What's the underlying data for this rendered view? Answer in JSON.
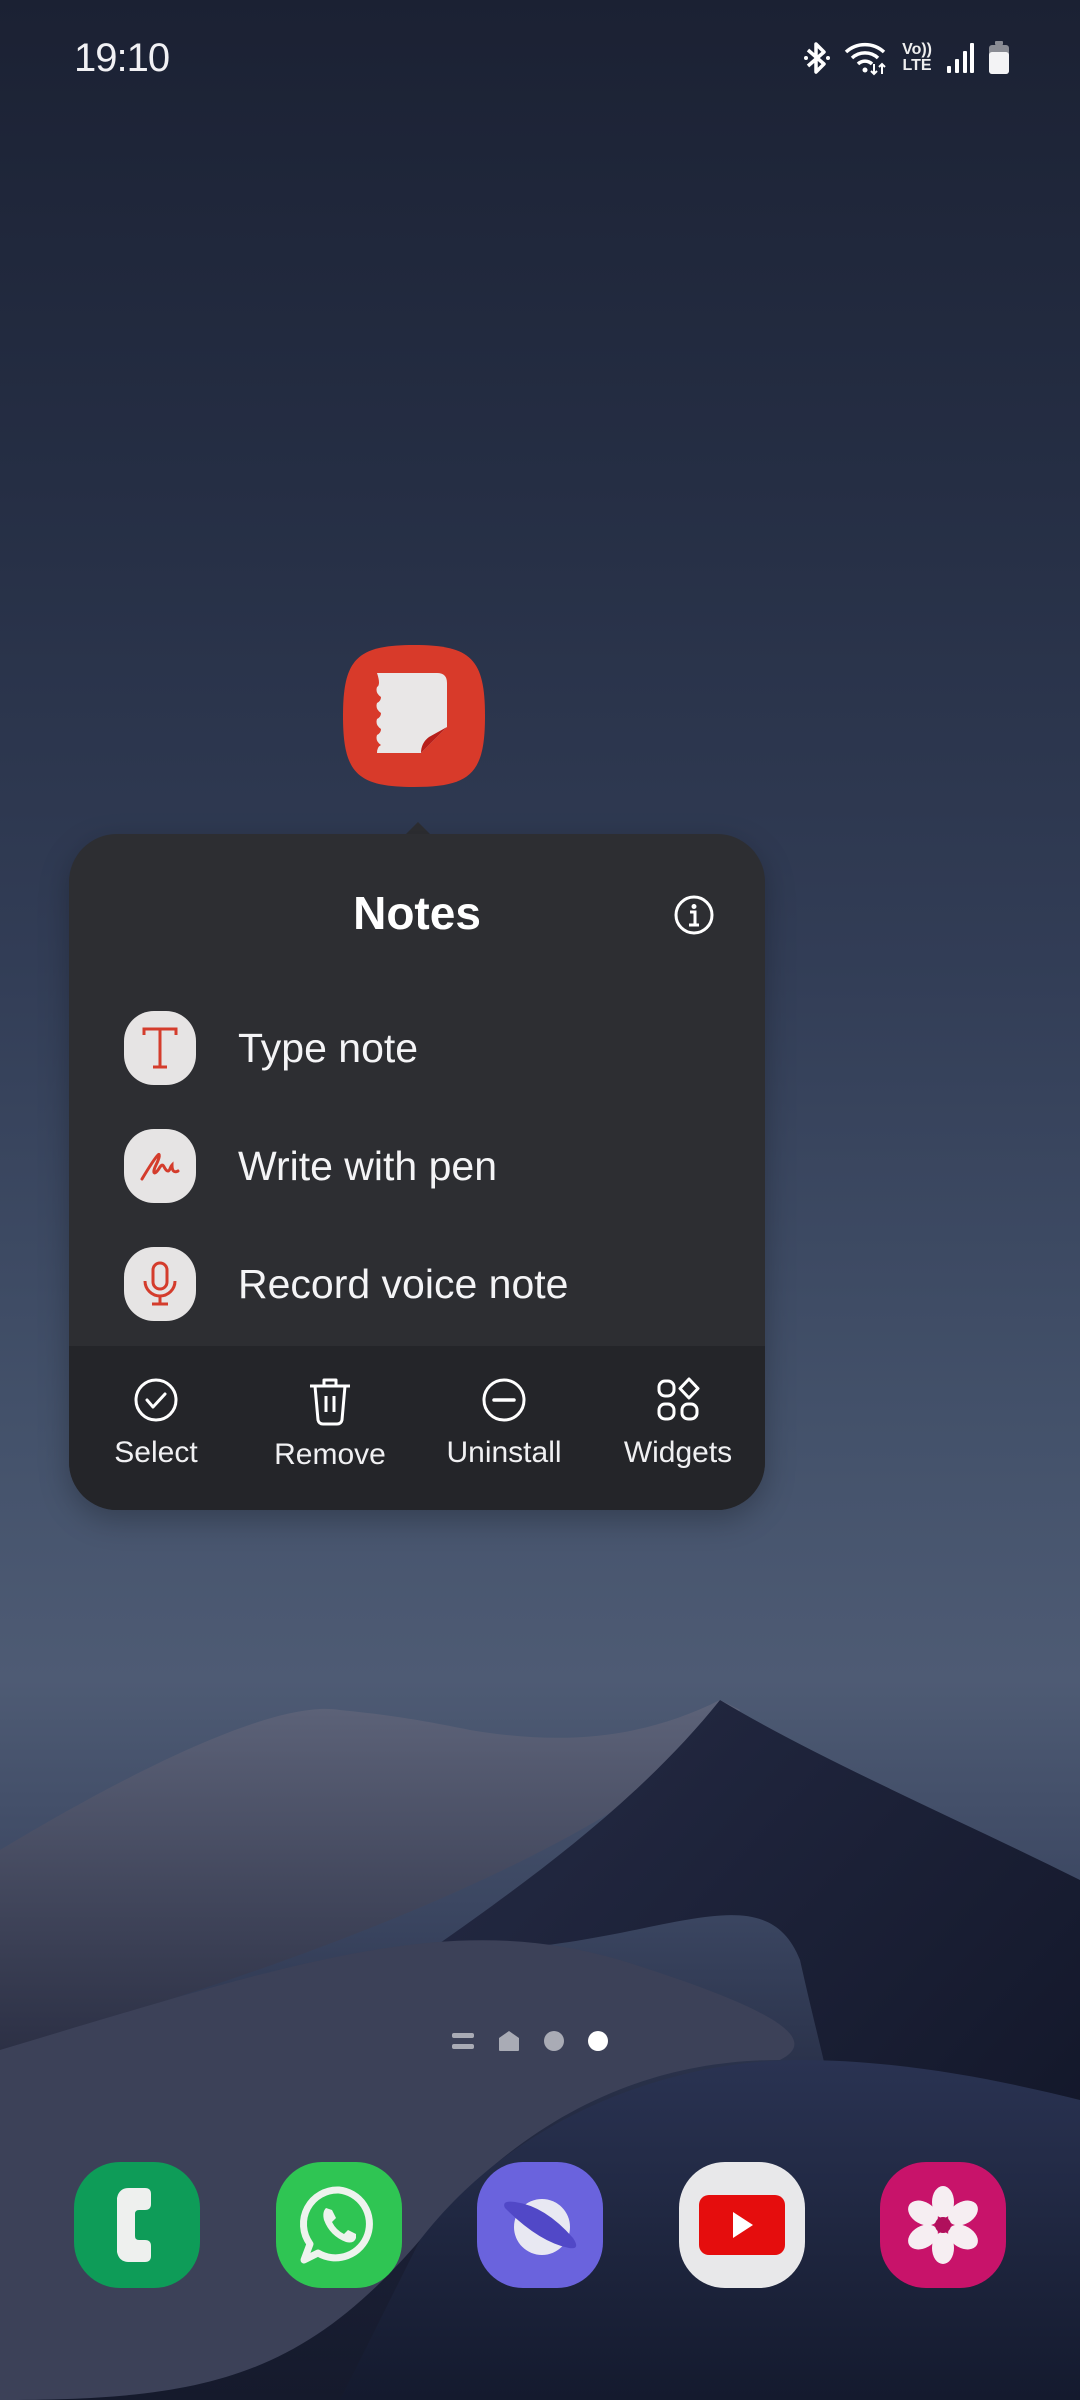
{
  "status_bar": {
    "time": "19:10",
    "icons": [
      "bluetooth-icon",
      "wifi-icon",
      "volte-icon",
      "signal-icon",
      "battery-icon"
    ],
    "volte_top": "Vo))",
    "volte_bottom": "LTE"
  },
  "app": {
    "name": "Notes",
    "icon": "samsung-notes-icon",
    "icon_color": "#d83a2a"
  },
  "popup": {
    "title": "Notes",
    "info_icon": "info-icon",
    "shortcuts": [
      {
        "label": "Type note",
        "icon": "type-text-icon"
      },
      {
        "label": "Write with pen",
        "icon": "handwriting-icon"
      },
      {
        "label": "Record voice note",
        "icon": "microphone-icon"
      }
    ],
    "actions": [
      {
        "label": "Select",
        "icon": "check-circle-icon"
      },
      {
        "label": "Remove",
        "icon": "trash-icon"
      },
      {
        "label": "Uninstall",
        "icon": "minus-circle-icon"
      },
      {
        "label": "Widgets",
        "icon": "widgets-icon"
      }
    ],
    "accent_color": "#d43c2c"
  },
  "page_indicator": {
    "items": [
      "menu-page",
      "home-page",
      "page-3",
      "page-4"
    ],
    "active_index": 3
  },
  "dock": {
    "apps": [
      {
        "name": "Phone",
        "icon": "phone-icon",
        "color": "#0e9c58"
      },
      {
        "name": "WhatsApp",
        "icon": "whatsapp-icon",
        "color": "#2fc553"
      },
      {
        "name": "Samsung Internet",
        "icon": "internet-planet-icon",
        "color": "#6a63dd"
      },
      {
        "name": "YouTube",
        "icon": "youtube-icon",
        "color": "#e8e8ea"
      },
      {
        "name": "Gallery",
        "icon": "gallery-flower-icon",
        "color": "#c8136a"
      }
    ]
  }
}
